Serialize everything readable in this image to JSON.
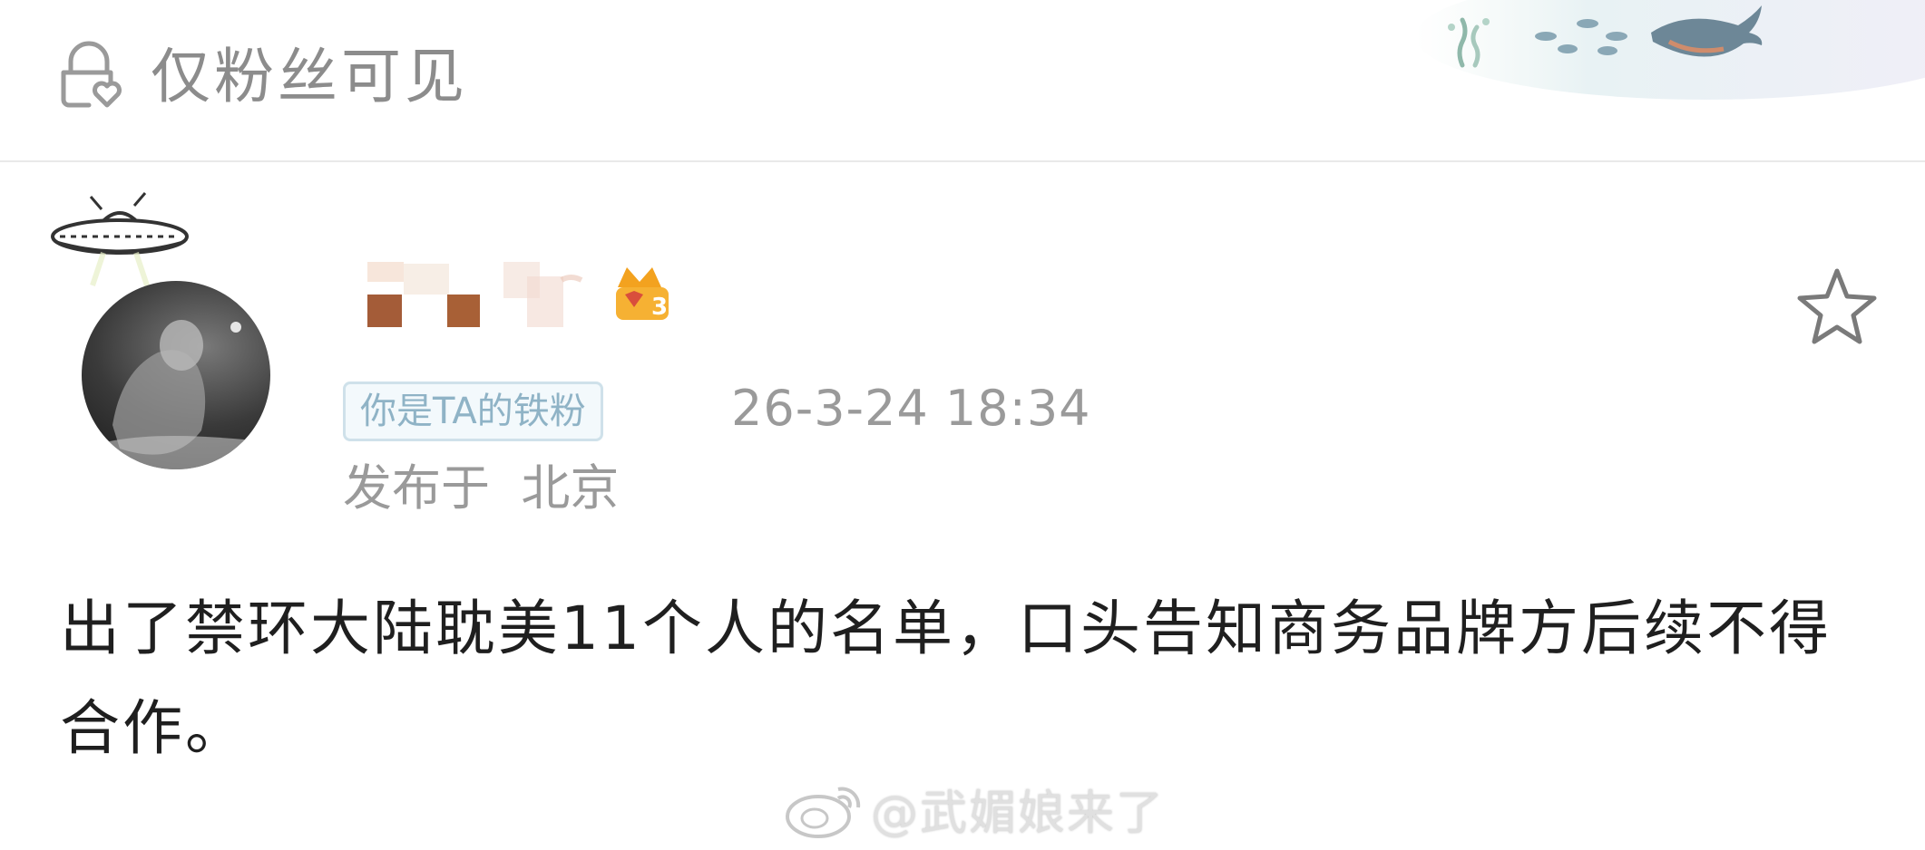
{
  "visibility": {
    "label": "仅粉丝可见",
    "icon": "lock-heart-icon"
  },
  "post": {
    "author": {
      "name_obscured": true,
      "fan_badge": "你是TA的铁粉",
      "level_badge": "3"
    },
    "time": "26-3-24 18:34",
    "location": "发布于  北京",
    "body": "出了禁环大陆耽美11个人的名单，口头告知商务品牌方后续不得合作。",
    "favorite_icon": "star-outline-icon"
  },
  "watermark": {
    "text": "@武媚娘来了",
    "icon": "weibo-logo-icon"
  },
  "colors": {
    "muted_text": "#8c8c8c",
    "meta_text": "#9a9a9a",
    "badge_border": "#cfe1ea",
    "badge_text": "#8fb3c6",
    "body_text": "#1f1f1f",
    "divider": "#e9e9e9"
  }
}
